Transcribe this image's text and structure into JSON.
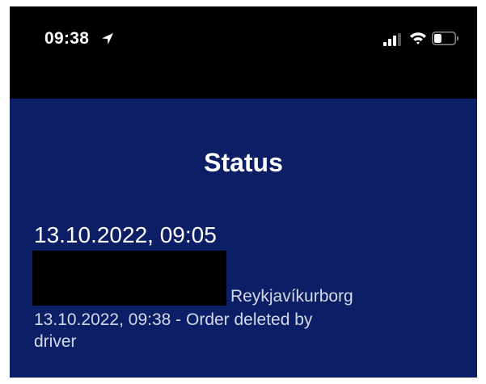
{
  "status_bar": {
    "time": "09:38",
    "icons": {
      "location": "location-arrow-icon",
      "signal": "cellular-signal-icon",
      "wifi": "wifi-icon",
      "battery": "battery-icon"
    },
    "battery_level": 0.35
  },
  "page": {
    "title": "Status"
  },
  "order": {
    "datetime": "13.10.2022, 09:05",
    "location": "Reykjavíkurborg",
    "event": "13.10.2022, 09:38 - Order deleted by driver"
  },
  "colors": {
    "background": "#0c1f66",
    "status_bar": "#000000",
    "text_primary": "#ffffff",
    "text_secondary": "#d4d8e6"
  }
}
